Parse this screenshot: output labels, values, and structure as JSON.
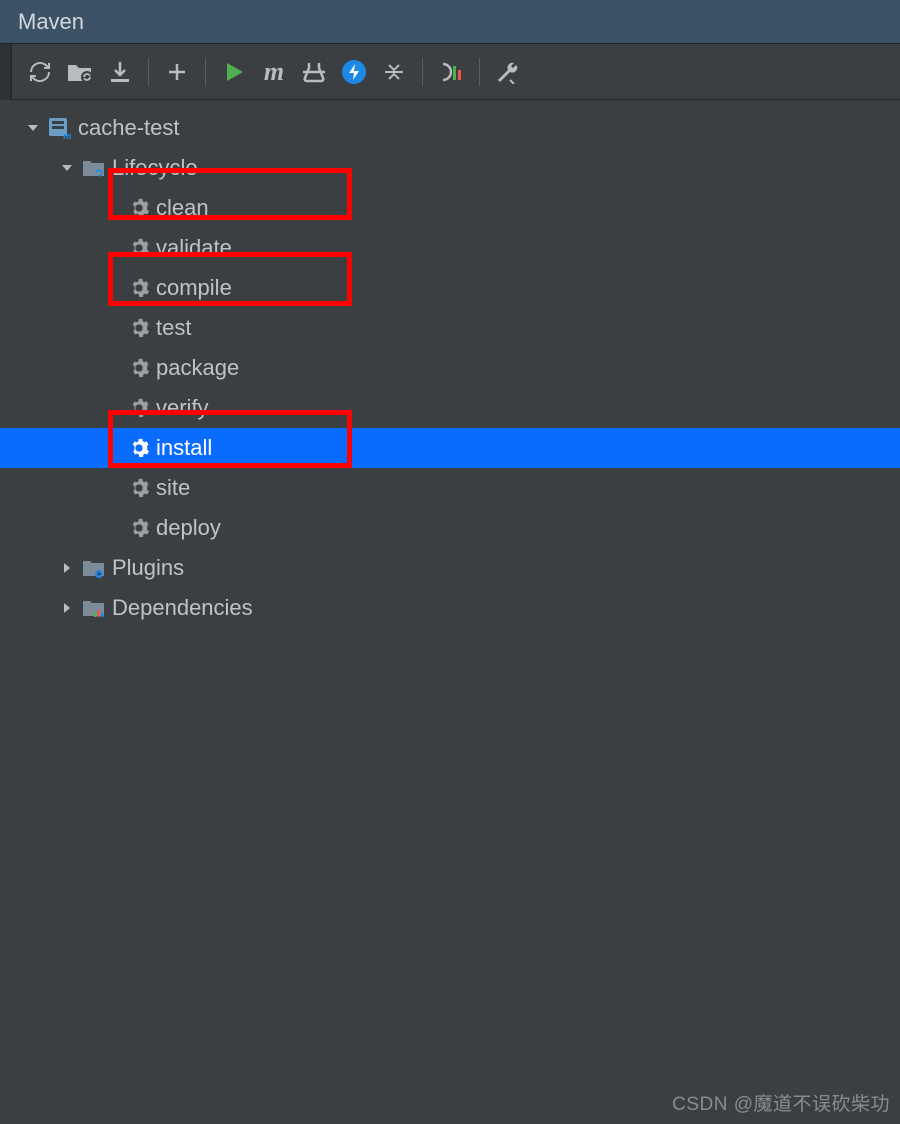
{
  "title": "Maven",
  "toolbar": {
    "refresh": "refresh",
    "generate": "generate-sources",
    "download": "download-sources",
    "add": "add",
    "run": "run",
    "m": "m",
    "skip": "toggle-skip-tests",
    "offline": "toggle-offline",
    "collapse": "collapse-all",
    "profiles": "show-profiles",
    "settings": "settings"
  },
  "tree": {
    "project": "cache-test",
    "lifecycle": {
      "label": "Lifecycle",
      "goals": [
        "clean",
        "validate",
        "compile",
        "test",
        "package",
        "verify",
        "install",
        "site",
        "deploy"
      ]
    },
    "plugins": "Plugins",
    "dependencies": "Dependencies"
  },
  "selected": "install",
  "highlighted": [
    "clean",
    "compile",
    "install"
  ],
  "watermark": "CSDN @魔道不误砍柴功"
}
